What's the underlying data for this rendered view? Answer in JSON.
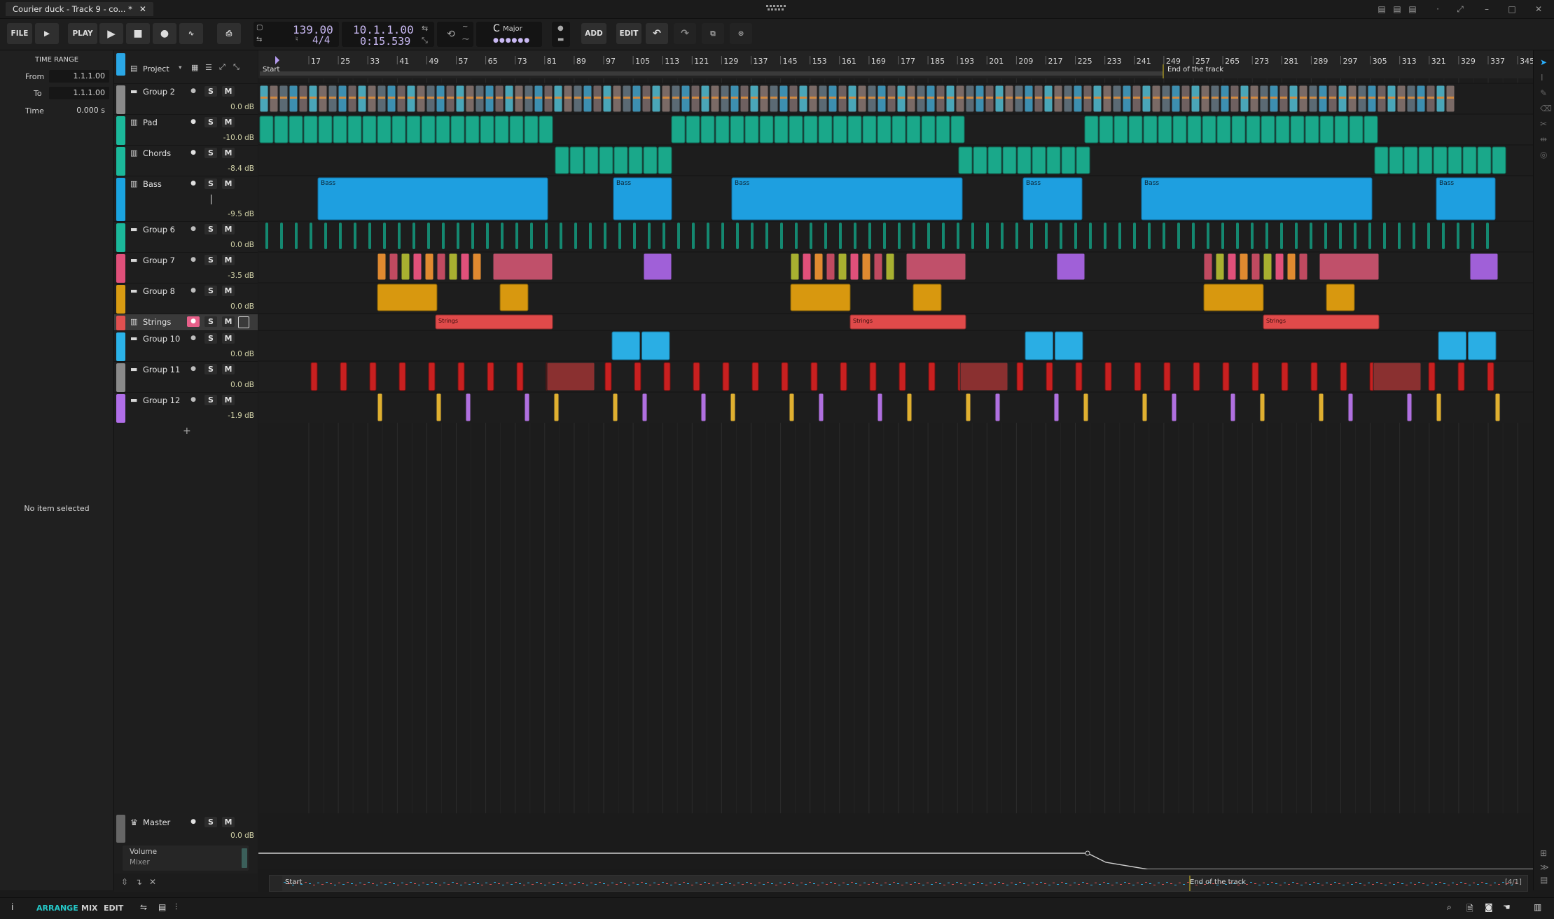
{
  "window": {
    "tab_title": "Courier duck - Track 9 - co... *"
  },
  "toolbar": {
    "file_label": "FILE",
    "play_label": "PLAY",
    "add_label": "ADD",
    "edit_label": "EDIT",
    "tempo": "139.00",
    "time_signature": "4/4",
    "position_bars": "10.1.1.00",
    "position_time": "0:15.539",
    "key_letter": "C",
    "key_mode": "Major"
  },
  "inspector": {
    "section_title": "TIME RANGE",
    "from_label": "From",
    "from_value": "1.1.1.00",
    "to_label": "To",
    "to_value": "1.1.1.00",
    "time_label": "Time",
    "time_value": "0.000 s",
    "empty_message": "No item selected"
  },
  "project_label": "Project",
  "tracks": [
    {
      "name": "Group 2",
      "icon": "folder-icon",
      "vol": "0.0 dB",
      "color": "#8a8a8a",
      "rec": false
    },
    {
      "name": "Pad",
      "icon": "piano-icon",
      "vol": "-10.0 dB",
      "color": "#1bb89a",
      "rec": true
    },
    {
      "name": "Chords",
      "icon": "piano-icon",
      "vol": "-8.4 dB",
      "color": "#1bb89a",
      "rec": true
    },
    {
      "name": "Bass",
      "icon": "piano-icon",
      "vol": "-9.5 dB",
      "color": "#1aa3e0",
      "rec": true
    },
    {
      "name": "Group 6",
      "icon": "folder-icon",
      "vol": "0.0 dB",
      "color": "#1bb89a",
      "rec": false
    },
    {
      "name": "Group 7",
      "icon": "folder-icon",
      "vol": "-3.5 dB",
      "color": "#e0507a",
      "rec": false
    },
    {
      "name": "Group 8",
      "icon": "folder-icon",
      "vol": "0.0 dB",
      "color": "#d89b12",
      "rec": false
    },
    {
      "name": "Strings",
      "icon": "piano-icon",
      "vol": "",
      "color": "#e05050",
      "rec": true
    },
    {
      "name": "Group 10",
      "icon": "folder-icon",
      "vol": "0.0 dB",
      "color": "#2bb2e8",
      "rec": false
    },
    {
      "name": "Group 11",
      "icon": "folder-icon",
      "vol": "0.0 dB",
      "color": "#8a8a8a",
      "rec": false
    },
    {
      "name": "Group 12",
      "icon": "folder-icon",
      "vol": "-1.9 dB",
      "color": "#b06ee8",
      "rec": false
    }
  ],
  "master": {
    "name": "Master",
    "vol": "0.0 dB",
    "automation_param": "Volume",
    "automation_device": "Mixer"
  },
  "buttons": {
    "solo": "S",
    "mute": "M"
  },
  "ruler": {
    "bars": [
      "17",
      "25",
      "33",
      "41",
      "49",
      "57",
      "65",
      "73",
      "81",
      "89",
      "97",
      "105",
      "113",
      "121",
      "129",
      "137",
      "145",
      "153",
      "161",
      "169",
      "177",
      "185",
      "193",
      "201",
      "209",
      "217",
      "225",
      "233",
      "241",
      "249",
      "257",
      "265",
      "273",
      "281",
      "289",
      "297",
      "305",
      "313",
      "321",
      "329",
      "337",
      "345"
    ],
    "start_marker": "Start",
    "end_marker": "End of the track"
  },
  "clip_labels": {
    "bass": "Bass",
    "strings": "Strings"
  },
  "overview": {
    "start": "Start",
    "end": "End of the track",
    "page": "[4/1]"
  },
  "statusbar": {
    "arrange": "ARRANGE",
    "mix": "MIX",
    "edit": "EDIT"
  }
}
